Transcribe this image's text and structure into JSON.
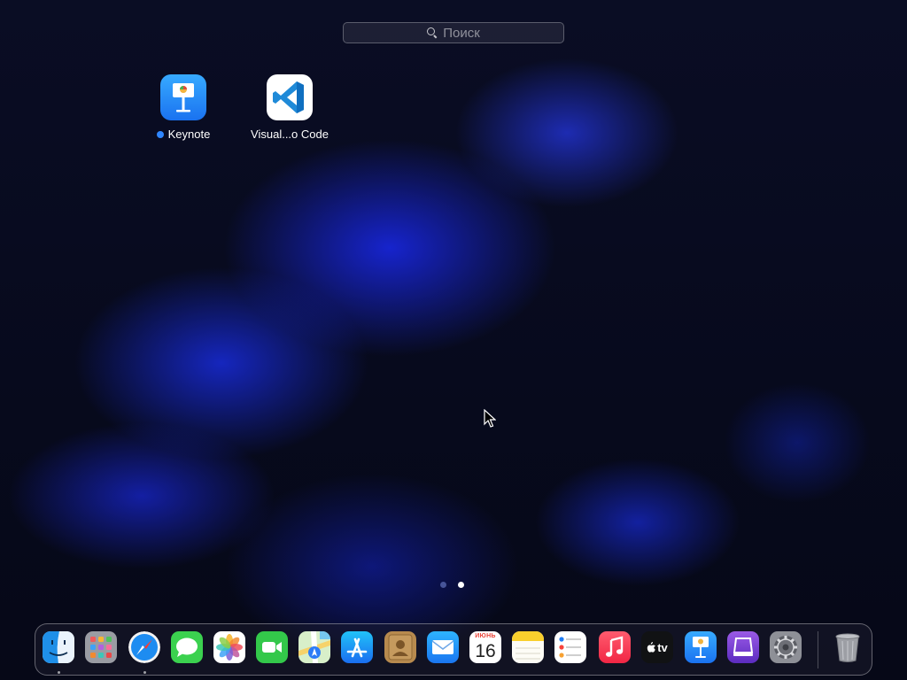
{
  "search": {
    "placeholder": "Поиск"
  },
  "launchpad": {
    "apps": [
      {
        "name": "Keynote",
        "new": true,
        "icon": "keynote-icon"
      },
      {
        "name": "Visual...o Code",
        "new": false,
        "icon": "vscode-icon"
      }
    ],
    "pages": {
      "count": 2,
      "current": 2
    }
  },
  "dock": {
    "items": [
      {
        "icon": "finder-icon",
        "running": true
      },
      {
        "icon": "launchpad-icon",
        "running": false
      },
      {
        "icon": "safari-icon",
        "running": true
      },
      {
        "icon": "messages-icon",
        "running": false
      },
      {
        "icon": "photos-icon",
        "running": false
      },
      {
        "icon": "facetime-icon",
        "running": false
      },
      {
        "icon": "maps-icon",
        "running": false
      },
      {
        "icon": "app-store-icon",
        "running": false
      },
      {
        "icon": "contacts-icon",
        "running": false
      },
      {
        "icon": "mail-icon",
        "running": false
      },
      {
        "icon": "calendar-icon",
        "running": false
      },
      {
        "icon": "notes-icon",
        "running": false
      },
      {
        "icon": "reminders-icon",
        "running": false
      },
      {
        "icon": "music-icon",
        "running": false
      },
      {
        "icon": "apple-tv-icon",
        "running": false
      },
      {
        "icon": "keynote-icon",
        "running": false
      },
      {
        "icon": "simulator-icon",
        "running": false
      },
      {
        "icon": "system-settings-icon",
        "running": false
      },
      {
        "icon": "trash-icon",
        "running": false
      }
    ],
    "calendar": {
      "month": "ИЮНЬ",
      "day": "16"
    },
    "tv_label": "tv"
  },
  "colors": {
    "accent": "#2f86ff",
    "background": "#070a1d"
  }
}
